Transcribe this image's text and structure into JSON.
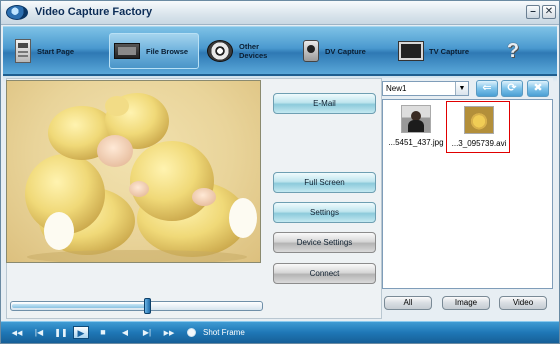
{
  "window": {
    "title": "Video Capture Factory",
    "minimize": "–",
    "close": "✕"
  },
  "nav": {
    "items": [
      {
        "label": "Start Page",
        "icon": "start-page-icon"
      },
      {
        "label": "File Browse",
        "icon": "file-browse-icon",
        "active": true
      },
      {
        "label_line1": "Other",
        "label_line2": "Devices",
        "icon": "other-devices-icon"
      },
      {
        "label": "DV Capture",
        "icon": "dv-camera-icon"
      },
      {
        "label": "TV Capture",
        "icon": "tv-icon"
      }
    ],
    "help": "?"
  },
  "side_buttons": {
    "email": "E-Mail",
    "full_screen": "Full Screen",
    "settings": "Settings",
    "device_settings": "Device Settings",
    "connect": "Connect"
  },
  "album": {
    "selected": "New1",
    "arrow": "▼"
  },
  "toolbar": {
    "back": "⇐",
    "refresh": "⟳",
    "delete": "✖"
  },
  "files": [
    {
      "name": "...5451_437.jpg",
      "type": "image",
      "selected": false
    },
    {
      "name": "...3_095739.avi",
      "type": "video",
      "selected": true
    }
  ],
  "filters": {
    "all": "All",
    "image": "Image",
    "video": "Video"
  },
  "playback": {
    "position": 0.54,
    "controls": {
      "rewind": "◀◀",
      "prev": "|◀",
      "pause": "❚❚",
      "play": "▶",
      "stop": "■",
      "step_back": "◀",
      "step_next": "▶|",
      "fast_forward": "▶▶"
    },
    "shot_frame_label": "Shot Frame"
  },
  "colors": {
    "accent": "#2f79b4",
    "selected_border": "#e00000"
  }
}
